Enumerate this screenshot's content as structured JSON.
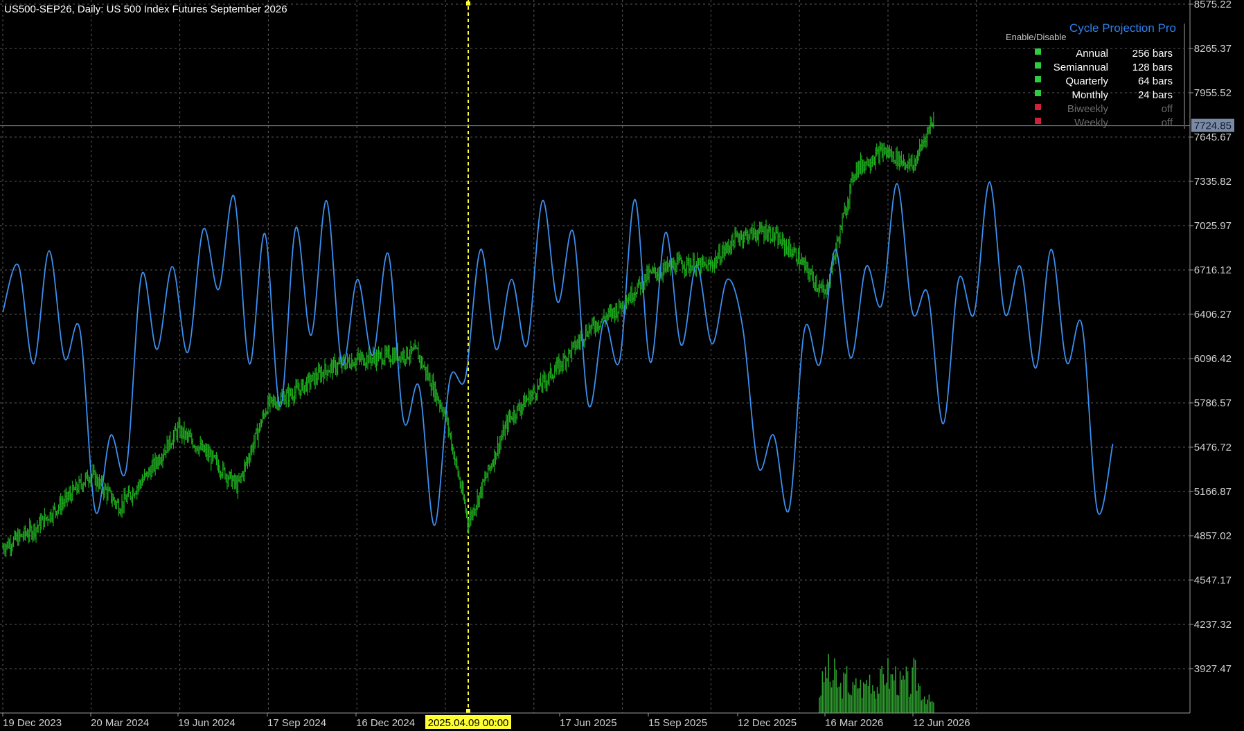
{
  "header": {
    "symbol_title": "US500-SEP26, Daily:  US 500 Index Futures September 2026"
  },
  "colors": {
    "background": "#000000",
    "grid": "#5a5a5a",
    "price_candles": "#1fae1f",
    "cycle_line": "#3d8ff0",
    "volume": "#2e9d2e",
    "cursor_line": "#ffff33",
    "enabled_dot": "#2ecc40",
    "disabled_dot": "#d0203a"
  },
  "panel": {
    "title": "Cycle Projection Pro",
    "enable_disable_label": "Enable/Disable",
    "cycles": [
      {
        "name": "Annual",
        "value": "256 bars",
        "enabled": true
      },
      {
        "name": "Semiannual",
        "value": "128 bars",
        "enabled": true
      },
      {
        "name": "Quarterly",
        "value": "64 bars",
        "enabled": true
      },
      {
        "name": "Monthly",
        "value": "24 bars",
        "enabled": true
      },
      {
        "name": "Biweekly",
        "value": "off",
        "enabled": false
      },
      {
        "name": "Weekly",
        "value": "off",
        "enabled": false
      }
    ]
  },
  "cursor": {
    "date_label": "2025.04.09 00:00"
  },
  "chart_data": {
    "type": "line",
    "title": "US500-SEP26, Daily:  US 500 Index Futures September 2026",
    "price_scale": {
      "min": 3617.32,
      "max": 8575.22,
      "ticks": [
        "8575.22",
        "8265.37",
        "7955.52",
        "7645.67",
        "7335.82",
        "7025.97",
        "6716.12",
        "6406.27",
        "6096.42",
        "5786.57",
        "5476.72",
        "5166.87",
        "4857.02",
        "4547.17",
        "4237.32",
        "3927.47"
      ],
      "current_price": "7724.85"
    },
    "x_ticks": [
      "19 Dec 2023",
      "20 Mar 2024",
      "19 Jun 2024",
      "17 Sep 2024",
      "16 Dec 2024",
      "2025.04.09 00:00",
      "17 Jun 2025",
      "15 Sep 2025",
      "12 Dec 2025",
      "16 Mar 2026",
      "12 Jun 2026"
    ],
    "grid": true,
    "series": [
      {
        "name": "",
        "kind": "candles",
        "dates": [
          "2023-12-19",
          "2024-01-20",
          "2024-02-20",
          "2024-03-20",
          "2024-04-19",
          "2024-05-20",
          "2024-06-19",
          "2024-07-20",
          "2024-08-18",
          "2024-09-17",
          "2024-10-17",
          "2024-11-16",
          "2024-12-16",
          "2025-01-16",
          "2025-02-16",
          "2025-03-17",
          "2025-04-09",
          "2025-05-10",
          "2025-06-17",
          "2025-07-16",
          "2025-08-16",
          "2025-09-15",
          "2025-10-16",
          "2025-11-14",
          "2025-12-12",
          "2026-01-13",
          "2026-02-13",
          "2026-03-16",
          "2026-04-15",
          "2026-05-14",
          "2026-06-12",
          "2026-07-03"
        ],
        "values": [
          4780,
          4900,
          5090,
          5290,
          5060,
          5300,
          5600,
          5420,
          5200,
          5770,
          5870,
          6020,
          6090,
          6110,
          6140,
          5700,
          4950,
          5680,
          6050,
          6300,
          6450,
          6680,
          6760,
          6740,
          6950,
          6990,
          6820,
          6540,
          7420,
          7550,
          7440,
          7790
        ]
      },
      {
        "name": "",
        "kind": "cycle_projection",
        "x_start": "2023-12-19",
        "x_end": "2026-12-29",
        "sample_values": [
          6420,
          6750,
          6060,
          6850,
          6100,
          6300,
          5030,
          5560,
          5320,
          6680,
          6160,
          6740,
          6140,
          7000,
          6580,
          7230,
          6060,
          6970,
          5760,
          7010,
          6260,
          7200,
          6060,
          6650,
          6120,
          6830,
          5660,
          5900,
          4930,
          5950,
          5960,
          6860,
          6160,
          6650,
          6190,
          7200,
          6490,
          6980,
          5770,
          6360,
          6080,
          7210,
          6070,
          6980,
          6190,
          6750,
          6200,
          6650,
          6310,
          5340,
          5560,
          5040,
          6300,
          6060,
          6860,
          6100,
          6740,
          6470,
          7320,
          6420,
          6550,
          5640,
          6650,
          6410,
          7330,
          6410,
          6740,
          6030,
          6860,
          6070,
          6330,
          5030,
          5500
        ]
      },
      {
        "name": "",
        "kind": "volume",
        "x_start": "2026-03-10",
        "x_end": "2026-07-03",
        "values": [
          0.4,
          0.7,
          1.0,
          0.6,
          0.85,
          0.5,
          0.6,
          0.75,
          0.45,
          0.55,
          0.65,
          0.5,
          0.7,
          0.8,
          0.55,
          0.6,
          0.75,
          0.95,
          0.7,
          0.85,
          0.65,
          0.6,
          0.7,
          0.5,
          0.85,
          0.65,
          0.45,
          0.35,
          0.25,
          0.2
        ]
      }
    ]
  }
}
